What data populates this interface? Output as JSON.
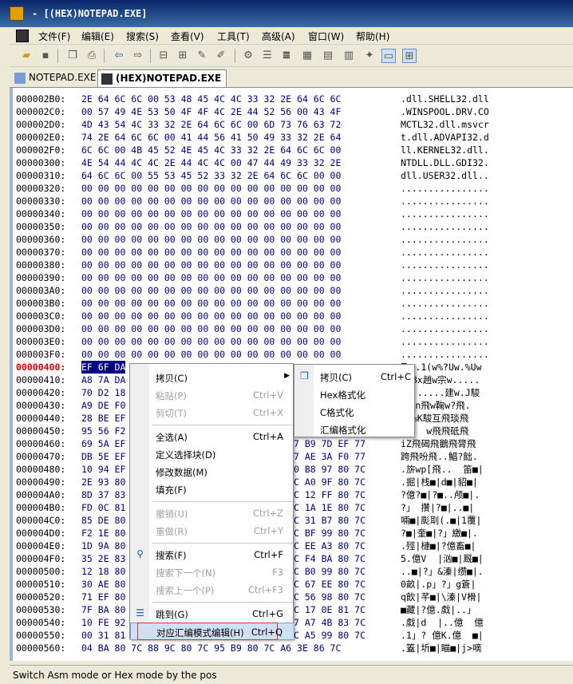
{
  "window": {
    "title": "- [(HEX)NOTEPAD.EXE]"
  },
  "menubar": {
    "items": [
      "文件(F)",
      "编辑(E)",
      "搜索(S)",
      "查看(V)",
      "工具(T)",
      "高级(A)",
      "窗口(W)",
      "帮助(H)"
    ]
  },
  "toolbar": {
    "buttons": [
      "open-icon",
      "save-icon",
      "copy-icon",
      "print-icon",
      "back-arrow-icon",
      "forward-arrow-icon",
      "asm-icon",
      "asm2-icon",
      "patch-icon",
      "patch2-icon",
      "cfg-icon",
      "list-icon",
      "list2-icon",
      "grid-icon",
      "grid2-icon",
      "grid3-icon",
      "plugin-icon",
      "hexmode-icon",
      "split-icon"
    ]
  },
  "tabs": [
    {
      "label": "NOTEPAD.EXE",
      "active": false
    },
    {
      "label": "(HEX)NOTEPAD.EXE",
      "active": true
    }
  ],
  "hex": {
    "lines": [
      {
        "off": "000002B0:",
        "hex": "2E 64 6C 6C 00 53 48 45 4C 4C 33 32 2E 64 6C 6C",
        "asc": ".dll.SHELL32.dll"
      },
      {
        "off": "000002C0:",
        "hex": "00 57 49 4E 53 50 4F 4F 4C 2E 44 52 56 00 43 4F",
        "asc": ".WINSPOOL.DRV.CO"
      },
      {
        "off": "000002D0:",
        "hex": "4D 43 54 4C 33 32 2E 64 6C 6C 00 6D 73 76 63 72",
        "asc": "MCTL32.dll.msvcr"
      },
      {
        "off": "000002E0:",
        "hex": "74 2E 64 6C 6C 00 41 44 56 41 50 49 33 32 2E 64",
        "asc": "t.dll.ADVAPI32.d"
      },
      {
        "off": "000002F0:",
        "hex": "6C 6C 00 4B 45 52 4E 45 4C 33 32 2E 64 6C 6C 00",
        "asc": "ll.KERNEL32.dll."
      },
      {
        "off": "00000300:",
        "hex": "4E 54 44 4C 4C 2E 44 4C 4C 00 47 44 49 33 32 2E",
        "asc": "NTDLL.DLL.GDI32."
      },
      {
        "off": "00000310:",
        "hex": "64 6C 6C 00 55 53 45 52 33 32 2E 64 6C 6C 00 00",
        "asc": "dll.USER32.dll.."
      },
      {
        "off": "00000320:",
        "hex": "00 00 00 00 00 00 00 00 00 00 00 00 00 00 00 00",
        "asc": "................"
      },
      {
        "off": "00000330:",
        "hex": "00 00 00 00 00 00 00 00 00 00 00 00 00 00 00 00",
        "asc": "................"
      },
      {
        "off": "00000340:",
        "hex": "00 00 00 00 00 00 00 00 00 00 00 00 00 00 00 00",
        "asc": "................"
      },
      {
        "off": "00000350:",
        "hex": "00 00 00 00 00 00 00 00 00 00 00 00 00 00 00 00",
        "asc": "................"
      },
      {
        "off": "00000360:",
        "hex": "00 00 00 00 00 00 00 00 00 00 00 00 00 00 00 00",
        "asc": "................"
      },
      {
        "off": "00000370:",
        "hex": "00 00 00 00 00 00 00 00 00 00 00 00 00 00 00 00",
        "asc": "................"
      },
      {
        "off": "00000380:",
        "hex": "00 00 00 00 00 00 00 00 00 00 00 00 00 00 00 00",
        "asc": "................"
      },
      {
        "off": "00000390:",
        "hex": "00 00 00 00 00 00 00 00 00 00 00 00 00 00 00 00",
        "asc": "................"
      },
      {
        "off": "000003A0:",
        "hex": "00 00 00 00 00 00 00 00 00 00 00 00 00 00 00 00",
        "asc": "................"
      },
      {
        "off": "000003B0:",
        "hex": "00 00 00 00 00 00 00 00 00 00 00 00 00 00 00 00",
        "asc": "................"
      },
      {
        "off": "000003C0:",
        "hex": "00 00 00 00 00 00 00 00 00 00 00 00 00 00 00 00",
        "asc": "................"
      },
      {
        "off": "000003D0:",
        "hex": "00 00 00 00 00 00 00 00 00 00 00 00 00 00 00 00",
        "asc": "................"
      },
      {
        "off": "000003E0:",
        "hex": "00 00 00 00 00 00 00 00 00 00 00 00 00 00 00 00",
        "asc": "................"
      },
      {
        "off": "000003F0:",
        "hex": "00 00 00 00 00 00 00 00 00 00 00 00 00 00 00 00",
        "asc": "................"
      },
      {
        "off": "00000400:",
        "hex": "EF 6F DA",
        "asc": "飞w.1(w%?Uw.%Uw",
        "red": true
      },
      {
        "off": "00000410:",
        "hex": "A8 7A DA",
        "asc": "..Bx趙w宗w....."
      },
      {
        "off": "00000420:",
        "hex": "70 D2 18",
        "asc": "p.......建w.J駿"
      },
      {
        "off": "00000430:",
        "hex": "A9 DE F0",
        "asc": "憊_n飛w鞠w?飛."
      },
      {
        "off": "00000440:",
        "hex": "28 BE EF",
        "asc": "(w%K駿互飛琰飛"
      },
      {
        "off": "00000450:",
        "hex": "95 56 F2",
        "asc": "篤\"  w飛飛砥飛"
      },
      {
        "off": "00000460:",
        "hex": "69 5A EF",
        "asc": "iZ飛碣飛鵝飛膂飛"
      },
      {
        "off": "00000470:",
        "hex": "DB 5E EF",
        "asc": "跨飛吩飛..鯧?飿."
      },
      {
        "off": "00000480:",
        "hex": "10 94 EF",
        "asc": ".旂wp[飛..  笛■|"
      },
      {
        "off": "00000490:",
        "hex": "2E 93 80",
        "asc": ".掘|栈■|d■|貂■|"
      },
      {
        "off": "000004A0:",
        "hex": "8D 37 83",
        "asc": "?億?■|?■..颅■|."
      },
      {
        "off": "000004B0:",
        "hex": "FD 0C 81",
        "asc": "?」 攢|?■|..■|"
      },
      {
        "off": "000004C0:",
        "hex": "85 DE 80",
        "asc": "啢■|颩刵(.■|1覆|"
      },
      {
        "off": "000004D0:",
        "hex": "F2 1E 80",
        "asc": "?■|奎■|?」繳■|."
      },
      {
        "off": "000004E0:",
        "hex": "1D 9A 80",
        "asc": ".殌|槤■|?億畜■|"
      },
      {
        "off": "000004F0:",
        "hex": "35 2E 83",
        "asc": "5.億V  |汹■|厩■|"
      },
      {
        "off": "00000500:",
        "hex": "12 18 80",
        "asc": "..■|?」&溱|缵■|."
      },
      {
        "off": "00000510:",
        "hex": "30 AE 80",
        "asc": "0畝|.p」?」g篬|"
      },
      {
        "off": "00000520:",
        "hex": "71 EF 80",
        "asc": "q飲|芊■|\\溱|V榾|"
      },
      {
        "off": "00000530:",
        "hex": "7F BA 80",
        "asc": "■藏|?億.戱|..」"
      },
      {
        "off": "00000540:",
        "hex": "10 FE 92",
        "asc": ".戱|d  |..億  億"
      },
      {
        "off": "00000550:",
        "hex": "00 31 81",
        "asc": ".1」? 億K.億  ■|"
      },
      {
        "off": "00000560:",
        "hex": "04 BA 80 7C 88 9C 80 7C 95 B9 80 7C A6 3E 86 7C",
        "asc": ".篕|圻■|瞄■|j>嘀"
      }
    ],
    "right_cols": [
      "7 B9 7D EF 77",
      "7 AE 3A F0 77",
      "0 B8 97 80 7C",
      "C A0 9F 80 7C",
      "C 12 FF 80 7C",
      "C 1A 1E 80 7C",
      "C 31 B7 80 7C",
      "C BF 99 80 7C",
      "C EE A3 80 7C",
      "C F4 BA 80 7C",
      "C B0 99 80 7C",
      "C 67 EE 80 7C",
      "C 56 98 80 7C",
      "C 17 0E 81 7C",
      "7 A7 4B 83 7C",
      "C A5 99 80 7C"
    ]
  },
  "context_menu": {
    "items": [
      {
        "label": "拷贝(C)",
        "key": "",
        "submenu": true
      },
      {
        "label": "粘贴(P)",
        "key": "Ctrl+V",
        "disabled": true
      },
      {
        "label": "剪切(T)",
        "key": "Ctrl+X",
        "disabled": true
      },
      {
        "label": "全选(A)",
        "key": "Ctrl+A"
      },
      {
        "label": "定义选择块(D)",
        "key": ""
      },
      {
        "label": "修改数据(M)",
        "key": ""
      },
      {
        "label": "填充(F)",
        "key": ""
      },
      {
        "label": "撤销(U)",
        "key": "Ctrl+Z",
        "disabled": true
      },
      {
        "label": "重做(R)",
        "key": "Ctrl+Y",
        "disabled": true
      },
      {
        "label": "搜索(F)",
        "key": "Ctrl+F"
      },
      {
        "label": "搜索下一个(N)",
        "key": "F3",
        "disabled": true
      },
      {
        "label": "搜索上一个(P)",
        "key": "Ctrl+F3",
        "disabled": true
      },
      {
        "label": "跳到(G)",
        "key": "Ctrl+G"
      },
      {
        "label": "对应汇编模式编辑(H)",
        "key": "Ctrl+Q",
        "highlighted": true
      }
    ]
  },
  "submenu": {
    "items": [
      {
        "label": "拷贝(C)",
        "key": "Ctrl+C"
      },
      {
        "label": "Hex格式化",
        "key": ""
      },
      {
        "label": "C格式化",
        "key": ""
      },
      {
        "label": "汇编格式化",
        "key": ""
      }
    ]
  },
  "status": {
    "text": "Switch Asm mode or Hex mode by the pos"
  }
}
